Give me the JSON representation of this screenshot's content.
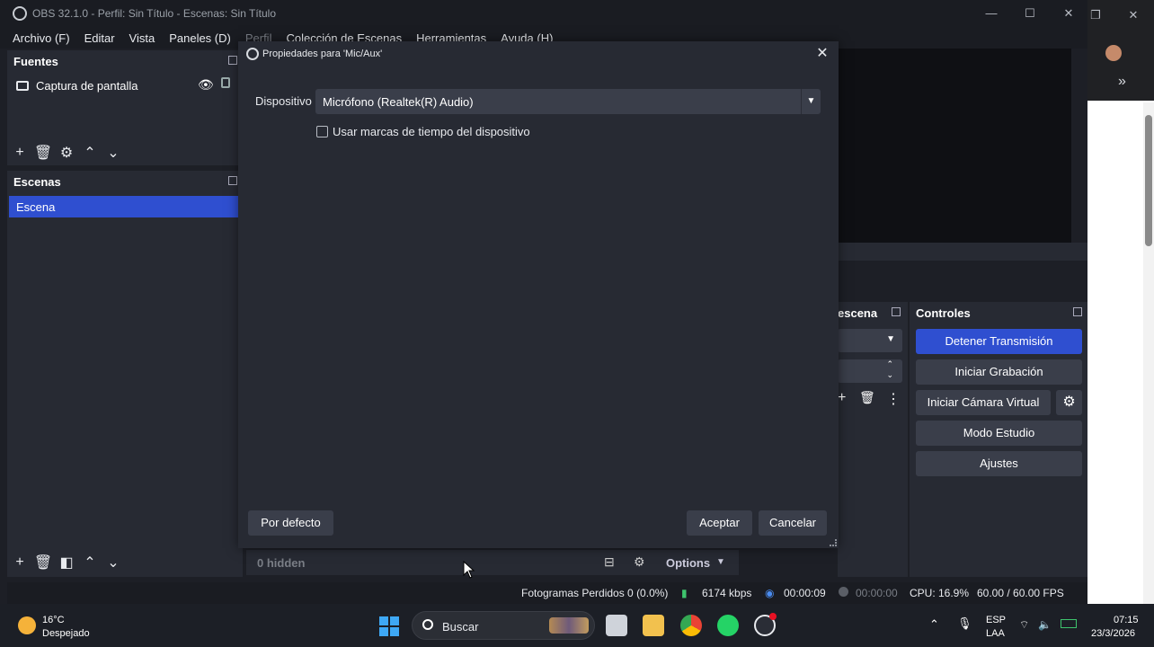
{
  "window": {
    "title": "OBS 32.1.0 - Perfil: Sin Título - Escenas: Sin Título",
    "menu": [
      "Archivo (F)",
      "Editar",
      "Vista",
      "Paneles (D)",
      "Perfil",
      "Colección de Escenas",
      "Herramientas",
      "Ayuda (H)"
    ]
  },
  "sources": {
    "header": "Fuentes",
    "items": [
      {
        "label": "Captura de pantalla",
        "icon": "monitor-icon"
      }
    ]
  },
  "scenes": {
    "header": "Escenas",
    "items": [
      {
        "label": "Escena",
        "selected": true
      }
    ]
  },
  "scene_transitions_header_partial": "escena",
  "controls": {
    "header": "Controles",
    "buttons": [
      "Detener Transmisión",
      "Iniciar Grabación",
      "Iniciar Cámara Virtual",
      "Modo Estudio",
      "Ajustes"
    ]
  },
  "mixer": {
    "hidden_label": "0 hidden",
    "options_label": "Options"
  },
  "dialog": {
    "title": "Propiedades para 'Mic/Aux'",
    "device_label": "Dispositivo",
    "device_value": "Micrófono (Realtek(R) Audio)",
    "checkbox_label": "Usar marcas de tiempo del dispositivo",
    "checkbox_checked": false,
    "defaults_button": "Por defecto",
    "accept_button": "Aceptar",
    "cancel_button": "Cancelar"
  },
  "status": {
    "dropped_frames": "Fotogramas Perdidos 0 (0.0%)",
    "bitrate": "6174 kbps",
    "stream_time": "00:00:09",
    "record_time": "00:00:00",
    "cpu": "CPU: 16.9%",
    "fps": "60.00 / 60.00 FPS"
  },
  "taskbar": {
    "weather_temp": "16°C",
    "weather_desc": "Despejado",
    "search_placeholder": "Buscar",
    "lang_top": "ESP",
    "lang_bottom": "LAA",
    "time": "07:15",
    "date": "23/3/2026"
  },
  "colors": {
    "accent": "#2f4fd0",
    "panel": "#272a33",
    "background": "#1d1f26"
  }
}
